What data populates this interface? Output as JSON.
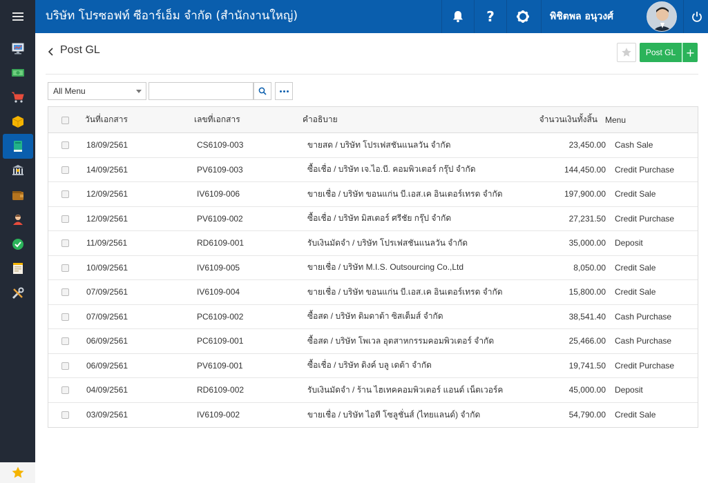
{
  "topbar": {
    "company": "บริษัท โปรซอฟท์ ซีอาร์เอ็ม จำกัด (สำนักงานใหญ่)",
    "user_name": "พิชิตพล อนุวงศ์",
    "icons": [
      "bell-icon",
      "question-icon",
      "gear-icon",
      "power-icon"
    ]
  },
  "sidebar": {
    "items": [
      "monitor-icon",
      "money-icon",
      "cart-icon",
      "box-icon",
      "book-icon",
      "bank-icon",
      "wallet-icon",
      "people-icon",
      "check-icon",
      "report-icon",
      "tools-icon"
    ],
    "active_index": 4,
    "favorite": "star-icon"
  },
  "header": {
    "title": "Post GL",
    "post_label": "Post GL",
    "plus_label": "+"
  },
  "filter": {
    "menu_value": "All Menu",
    "search_value": ""
  },
  "table": {
    "columns": {
      "date": "วันที่เอกสาร",
      "doc": "เลขที่เอกสาร",
      "desc": "คำอธิบาย",
      "amount": "จำนวนเงินทั้งสิ้น",
      "menu": "Menu"
    },
    "rows": [
      {
        "date": "18/09/2561",
        "doc": "CS6109-003",
        "desc": "ขายสด / บริษัท โปรเฟสชันแนลวัน จำกัด",
        "amount": "23,450.00",
        "menu": "Cash Sale"
      },
      {
        "date": "14/09/2561",
        "doc": "PV6109-003",
        "desc": "ซื้อเชื่อ / บริษัท เจ.ไอ.บี. คอมพิวเตอร์ กรุ๊ป จำกัด",
        "amount": "144,450.00",
        "menu": "Credit Purchase"
      },
      {
        "date": "12/09/2561",
        "doc": "IV6109-006",
        "desc": "ขายเชื่อ / บริษัท ขอนแก่น บี.เอส.เค อินเตอร์เทรด จำกัด",
        "amount": "197,900.00",
        "menu": "Credit Sale"
      },
      {
        "date": "12/09/2561",
        "doc": "PV6109-002",
        "desc": "ซื้อเชื่อ / บริษัท มิสเตอร์ ศรีชัย กรุ๊ป จำกัด",
        "amount": "27,231.50",
        "menu": "Credit Purchase"
      },
      {
        "date": "11/09/2561",
        "doc": "RD6109-001",
        "desc": "รับเงินมัดจำ / บริษัท โปรเฟสชันแนลวัน จำกัด",
        "amount": "35,000.00",
        "menu": "Deposit"
      },
      {
        "date": "10/09/2561",
        "doc": "IV6109-005",
        "desc": "ขายเชื่อ / บริษัท M.I.S. Outsourcing Co.,Ltd",
        "amount": "8,050.00",
        "menu": "Credit Sale"
      },
      {
        "date": "07/09/2561",
        "doc": "IV6109-004",
        "desc": "ขายเชื่อ / บริษัท ขอนแก่น บี.เอส.เค อินเตอร์เทรด จำกัด",
        "amount": "15,800.00",
        "menu": "Credit Sale"
      },
      {
        "date": "07/09/2561",
        "doc": "PC6109-002",
        "desc": "ซื้อสด / บริษัท ดิมดาต้า ซิสเต็มส์ จำกัด",
        "amount": "38,541.40",
        "menu": "Cash Purchase"
      },
      {
        "date": "06/09/2561",
        "doc": "PC6109-001",
        "desc": "ซื้อสด / บริษัท โพเวล อุตสาหกรรมคอมพิวเตอร์ จำกัด",
        "amount": "25,466.00",
        "menu": "Cash Purchase"
      },
      {
        "date": "06/09/2561",
        "doc": "PV6109-001",
        "desc": "ซื้อเชื่อ / บริษัท ดิงค์ บลู เดต้า จำกัด",
        "amount": "19,741.50",
        "menu": "Credit Purchase"
      },
      {
        "date": "04/09/2561",
        "doc": "RD6109-002",
        "desc": "รับเงินมัดจำ / ร้าน ไฮเทคคอมพิวเตอร์ แอนด์ เน็ตเวอร์ค",
        "amount": "45,000.00",
        "menu": "Deposit"
      },
      {
        "date": "03/09/2561",
        "doc": "IV6109-002",
        "desc": "ขายเชื่อ / บริษัท ไอที โซลูชั่นส์ (ไทยแลนด์) จำกัด",
        "amount": "54,790.00",
        "menu": "Credit Sale"
      }
    ]
  }
}
